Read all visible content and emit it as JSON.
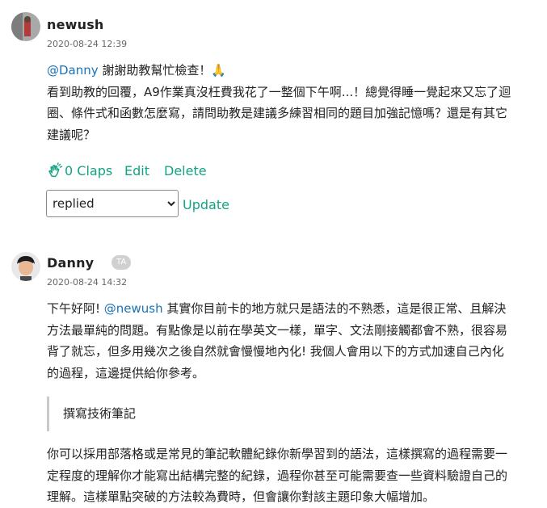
{
  "comment1": {
    "author": "newush",
    "timestamp": "2020-08-24 12:39",
    "mention": "@Danny",
    "line1_rest": " 謝謝助教幫忙檢查！🙏",
    "lines": [
      "看到助教的回覆，A9作業真沒枉費我花了一整個下午啊...！總覺得睡一覺起來又忘了迴",
      "圈、條件式和函數怎麼寫，請問助教是建議多練習相同的題目加強記憶嗎？還是有其它",
      "建議呢？"
    ],
    "claps_label": "0 Claps",
    "edit_label": "Edit",
    "delete_label": "Delete",
    "status_select": {
      "selected": "replied",
      "options": [
        "replied"
      ]
    },
    "update_label": "Update"
  },
  "comment2": {
    "author": "Danny",
    "badge": "TA",
    "timestamp": "2020-08-24 14:32",
    "line1_prefix": "下午好阿! ",
    "mention": "@newush",
    "line1_rest": " 其實你目前卡的地方就只是語法的不熟悉，這是很正常、且解決",
    "lines": [
      "方法最單純的問題。有點像是以前在學英文一樣，單字、文法剛接觸都會不熟，很容易",
      "背了就忘，但多用幾次之後自然就會慢慢地內化! 我個人會用以下的方式加速自己內化",
      "的過程，這邊提供給你參考。"
    ],
    "quote": "撰寫技術筆記",
    "paragraph2": [
      "你可以採用部落格或是常見的筆記軟體紀錄你新學習到的語法，這樣撰寫的過程需要一",
      "定程度的理解你才能寫出結構完整的紀錄，過程你甚至可能需要查一些資料驗證自己的",
      "理解。這樣單點突破的方法較為費時，但會讓你對該主題印象大幅增加。"
    ]
  },
  "colors": {
    "link_green": "#13a383",
    "mention_blue": "#1a73b8"
  }
}
